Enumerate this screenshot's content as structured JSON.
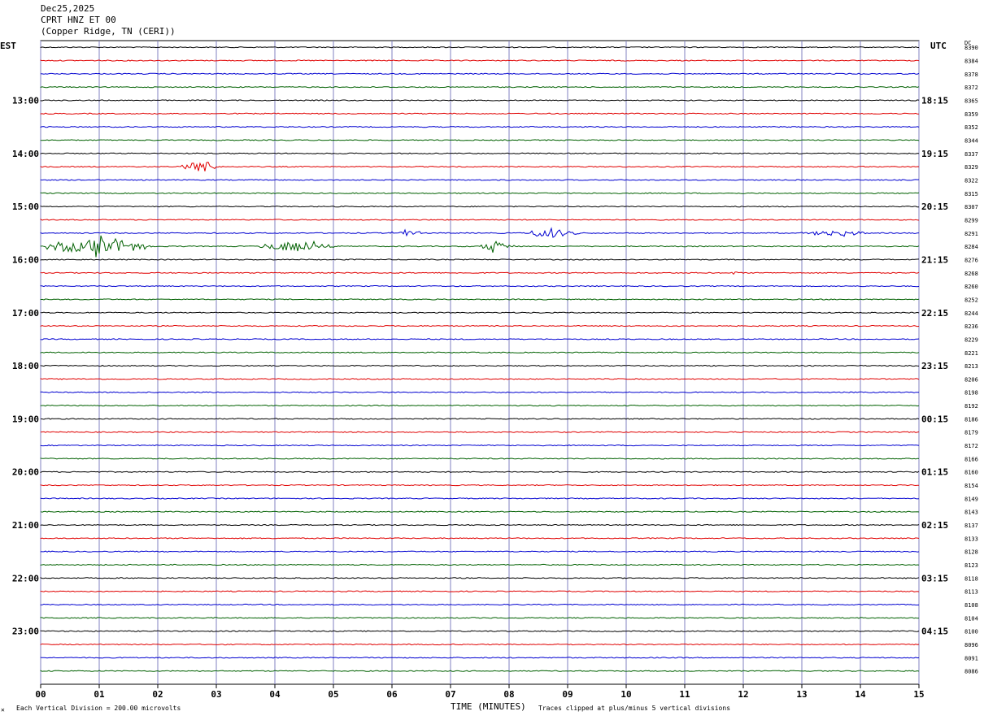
{
  "header": {
    "date": "Dec25,2025",
    "station": "CPRT HNZ ET 00",
    "location": "(Copper Ridge, TN (CERI))"
  },
  "left_axis_label": "EST",
  "right_axis_label": "UTC",
  "dc_label": "DC",
  "footer": {
    "scale_note": "Each Vertical Division =  200.00 microvolts",
    "xlabel": "TIME (MINUTES)",
    "clip_note": "Traces clipped at plus/minus 5 vertical divisions",
    "corner_mark": "✕"
  },
  "colors": {
    "trace_cycle": [
      "#000000",
      "#e00000",
      "#0000d0",
      "#006000"
    ],
    "vertical_grid": "#8080c0",
    "border": "#000000"
  },
  "chart_data": {
    "type": "line",
    "description_type": "helicorder",
    "x_ticks": [
      "00",
      "01",
      "02",
      "03",
      "04",
      "05",
      "06",
      "07",
      "08",
      "09",
      "10",
      "11",
      "12",
      "13",
      "14",
      "15"
    ],
    "xlim": [
      0,
      15
    ],
    "row_count": 48,
    "est_hour_labels": [
      "13:00",
      "14:00",
      "15:00",
      "16:00",
      "17:00",
      "18:00",
      "19:00",
      "20:00",
      "21:00",
      "22:00",
      "23:00"
    ],
    "utc_hour_labels": [
      "18:15",
      "19:15",
      "20:15",
      "21:15",
      "22:15",
      "23:15",
      "00:15",
      "01:15",
      "02:15",
      "03:15",
      "04:15"
    ],
    "dc_values": [
      "8390",
      "8384",
      "8378",
      "8372",
      "8365",
      "8359",
      "8352",
      "8344",
      "8337",
      "8329",
      "8322",
      "8315",
      "8307",
      "8299",
      "8291",
      "8284",
      "8276",
      "8268",
      "8260",
      "8252",
      "8244",
      "8236",
      "8229",
      "8221",
      "8213",
      "8206",
      "8198",
      "8192",
      "8186",
      "8179",
      "8172",
      "8166",
      "8160",
      "8154",
      "8149",
      "8143",
      "8137",
      "8133",
      "8128",
      "8123",
      "8118",
      "8113",
      "8108",
      "8104",
      "8100",
      "8096",
      "8091",
      "8086"
    ],
    "events": [
      {
        "row": 9,
        "minute_start": 2.4,
        "minute_end": 3.0,
        "amplitude": 0.9
      },
      {
        "row": 14,
        "minute_start": 6.0,
        "minute_end": 6.5,
        "amplitude": 0.5
      },
      {
        "row": 14,
        "minute_start": 8.3,
        "minute_end": 9.2,
        "amplitude": 0.6
      },
      {
        "row": 14,
        "minute_start": 13.0,
        "minute_end": 14.2,
        "amplitude": 0.35
      },
      {
        "row": 15,
        "minute_start": 0.1,
        "minute_end": 1.9,
        "amplitude": 1.0
      },
      {
        "row": 15,
        "minute_start": 3.7,
        "minute_end": 5.0,
        "amplitude": 0.7
      },
      {
        "row": 15,
        "minute_start": 7.5,
        "minute_end": 8.1,
        "amplitude": 0.85
      },
      {
        "row": 17,
        "minute_start": 11.8,
        "minute_end": 11.9,
        "amplitude": 0.25
      }
    ]
  }
}
